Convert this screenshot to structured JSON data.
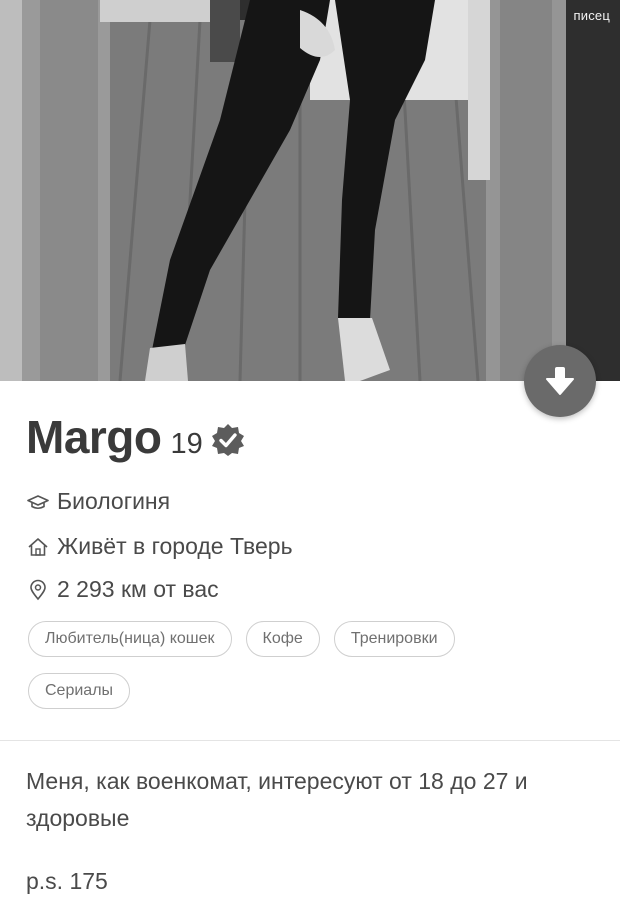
{
  "watermark": "писец",
  "profile": {
    "name": "Margo",
    "age": "19",
    "verified": true,
    "school": "Биологиня",
    "city": "Живёт в городе Тверь",
    "distance": "2 293 км от вас"
  },
  "interests": {
    "row1": [
      "Любитель(ница) кошек",
      "Кофе",
      "Тренировки"
    ],
    "row2": [
      "Сериалы"
    ]
  },
  "bio": {
    "text": "Меня, как военкомат, интересуют от 18 до 27 и здоровые",
    "ps": "p.s. 175"
  },
  "icons": {
    "scroll_down": "arrow-down-icon",
    "verified": "verified-badge-icon",
    "school": "graduation-cap-icon",
    "home": "home-icon",
    "location": "location-pin-icon"
  },
  "colors": {
    "fab": "#6a6a6a",
    "chip_border": "#cfcfcf",
    "text": "#3a3a3a"
  }
}
